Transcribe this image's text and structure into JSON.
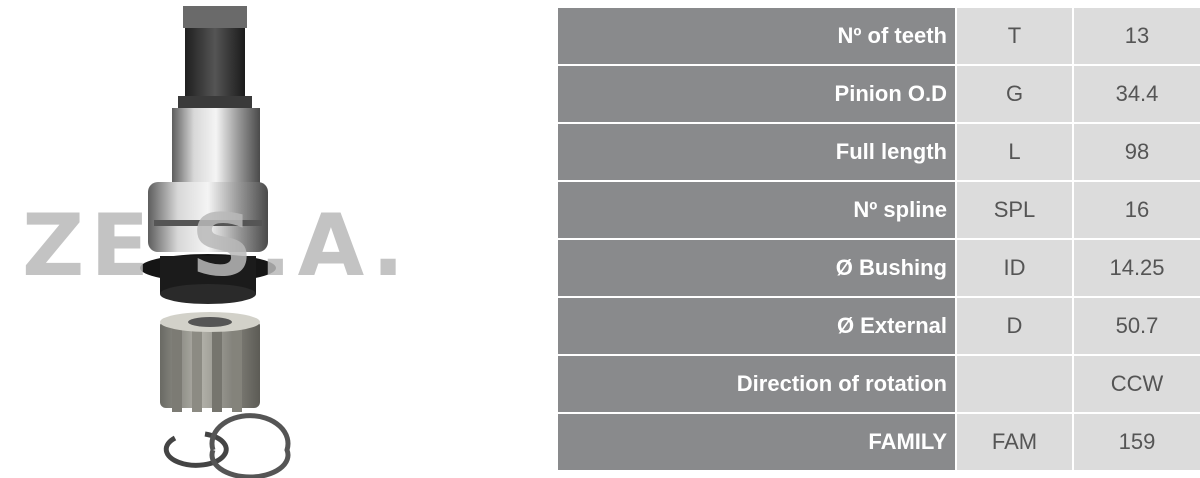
{
  "watermark": "ZE  S.A.",
  "specs": [
    {
      "label": "Nº of teeth",
      "code": "T",
      "value": "13"
    },
    {
      "label": "Pinion O.D",
      "code": "G",
      "value": "34.4"
    },
    {
      "label": "Full length",
      "code": "L",
      "value": "98"
    },
    {
      "label": "Nº spline",
      "code": "SPL",
      "value": "16"
    },
    {
      "label": "Ø Bushing",
      "code": "ID",
      "value": "14.25"
    },
    {
      "label": "Ø External",
      "code": "D",
      "value": "50.7"
    },
    {
      "label": "Direction of rotation",
      "code": "",
      "value": "CCW"
    },
    {
      "label": "FAMILY",
      "code": "FAM",
      "value": "159"
    }
  ],
  "colors": {
    "label_bg": "#898a8c",
    "cell_bg": "#dcdcdc",
    "label_text": "#ffffff",
    "cell_text": "#555555"
  }
}
